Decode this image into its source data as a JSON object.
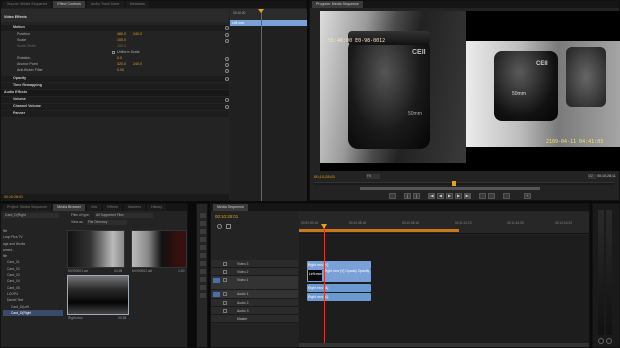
{
  "effect_controls": {
    "tabs": [
      "Source: Media Sequence",
      "Effect Controls",
      "Audio Track Mixer",
      "Metadata"
    ],
    "clip_label": "Left.mov",
    "video_effects_header": "Video Effects",
    "motion": "Motion",
    "position": {
      "label": "Position",
      "v1": "480.0",
      "v2": "240.0"
    },
    "scale": {
      "label": "Scale",
      "value": "100.0"
    },
    "scale_width": {
      "label": "Scale Width",
      "value": "100.0"
    },
    "uniform_scale": "Uniform Scale",
    "rotation": {
      "label": "Rotation",
      "value": "0.0"
    },
    "anchor_point": {
      "label": "Anchor Point",
      "v1": "320.0",
      "v2": "240.0"
    },
    "anti_flicker": {
      "label": "Anti-flicker Filter",
      "value": "0.00"
    },
    "opacity": "Opacity",
    "time_remapping": "Time Remapping",
    "audio_effects_header": "Audio Effects",
    "volume": "Volume",
    "channel_volume": "Channel Volume",
    "panner": "Panner",
    "ruler": "00:10:00",
    "timecode": "00:10:28:01"
  },
  "program": {
    "title": "Program: Media Sequence",
    "overlay_tc": "55:48:00  E0-98-0012",
    "overlay_date": "2109-04-11  04:41:03",
    "lens_text_left": "CEII",
    "lens_text_right": "CEII",
    "mm_left": "50mm",
    "mm_right": "50mm",
    "current_tc": "00;10;28;01",
    "fit": "Fit",
    "quality": "1/2",
    "duration_tc": "00;10;28;11"
  },
  "project": {
    "tabs": [
      "Project: Media Sequence",
      "Media Browser",
      "Info",
      "Effects",
      "Markers",
      "History"
    ],
    "drive": "Card_D(Right",
    "files_of_type_label": "Files of type:",
    "files_of_type": "All Supported Files",
    "view_as_label": "View as:",
    "view_as": "File Directory",
    "tree": [
      "file",
      "Loop Pics TV",
      "age and Works",
      "amera",
      "file",
      "Card_01",
      "Card_02",
      "Card_03",
      "Card_04",
      "Card_05",
      "LOOP3",
      "Daniel Test",
      "Card_D(Left",
      "Card_D(Right"
    ],
    "thumbs": [
      {
        "name": "MVI00001.avi",
        "dur": "00;28"
      },
      {
        "name": "MVI00002.avi",
        "dur": "1;00"
      },
      {
        "name": "Right.mov",
        "dur": "00;28"
      }
    ]
  },
  "timeline": {
    "tab": "Media Sequence",
    "timecode": "00:10:28:01",
    "ruler": [
      "00:00:09:18",
      "00:10:08:18",
      "00:10:08:18",
      "00:11:12:23",
      "00:11:44:00",
      "00:12:16:23"
    ],
    "tracks": [
      "Video 3",
      "Video 2",
      "Video 1",
      "Audio 1",
      "Audio 2",
      "Audio 3",
      "Master"
    ],
    "clips": {
      "v2": "Right.mov [V]",
      "v1a": "Left.mov",
      "v1b": "Right.mov [V]  Opacity Opacity",
      "a1": "Right.mov [A]",
      "a2": "Right.mov [A]"
    }
  },
  "colors": {
    "timecode": "#e2a21e",
    "clip_video": "#7aa0d8",
    "clip_audio": "#6b9ad0",
    "playhead": "#d23a2a"
  }
}
